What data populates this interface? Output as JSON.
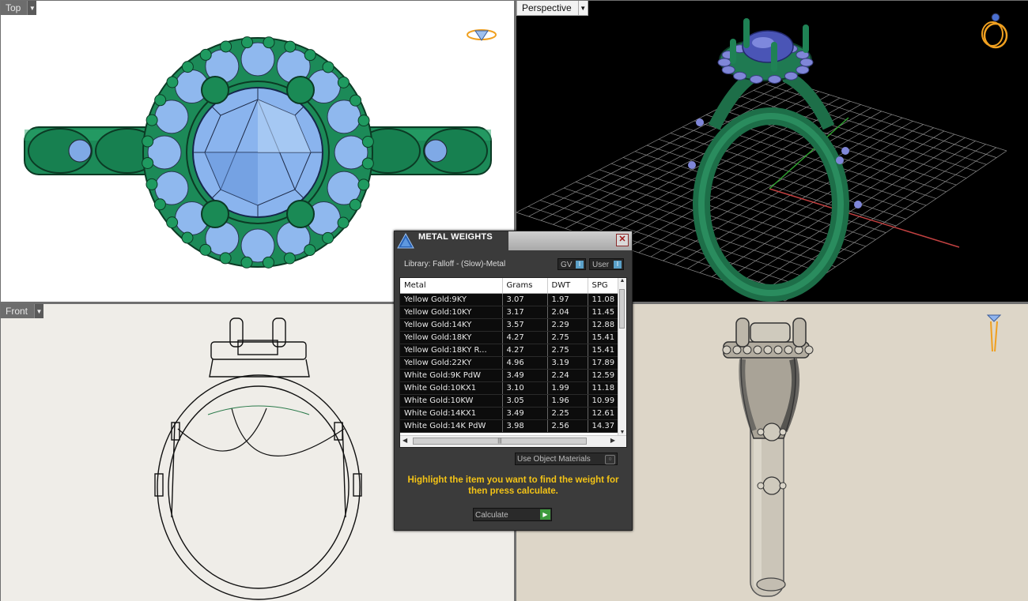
{
  "viewports": {
    "top": {
      "label": "Top"
    },
    "perspective": {
      "label": "Perspective"
    },
    "front": {
      "label": "Front"
    }
  },
  "dialog": {
    "title": "METAL WEIGHTS",
    "library_text": "Library: Falloff - (Slow)-Metal",
    "toggle_gv": "GV",
    "toggle_user": "User",
    "columns": [
      "Metal",
      "Grams",
      "DWT",
      "SPG"
    ],
    "rows": [
      [
        "Yellow Gold:9KY",
        "3.07",
        "1.97",
        "11.08"
      ],
      [
        "Yellow Gold:10KY",
        "3.17",
        "2.04",
        "11.45"
      ],
      [
        "Yellow Gold:14KY",
        "3.57",
        "2.29",
        "12.88"
      ],
      [
        "Yellow Gold:18KY",
        "4.27",
        "2.75",
        "15.41"
      ],
      [
        "Yellow Gold:18KY R...",
        "4.27",
        "2.75",
        "15.41"
      ],
      [
        "Yellow Gold:22KY",
        "4.96",
        "3.19",
        "17.89"
      ],
      [
        "White Gold:9K PdW",
        "3.49",
        "2.24",
        "12.59"
      ],
      [
        "White Gold:10KX1",
        "3.10",
        "1.99",
        "11.18"
      ],
      [
        "White Gold:10KW",
        "3.05",
        "1.96",
        "10.99"
      ],
      [
        "White Gold:14KX1",
        "3.49",
        "2.25",
        "12.61"
      ],
      [
        "White Gold:14K PdW",
        "3.98",
        "2.56",
        "14.37"
      ]
    ],
    "use_object_materials": "Use Object Materials",
    "hint": "Highlight the item you want to find the weight for then press calculate.",
    "calculate": "Calculate"
  },
  "colors": {
    "metal_green": "#1f8a5a",
    "gem_blue": "#7fa9e6",
    "hint_yellow": "#f3c316",
    "gizmo_orange": "#f0a020"
  }
}
